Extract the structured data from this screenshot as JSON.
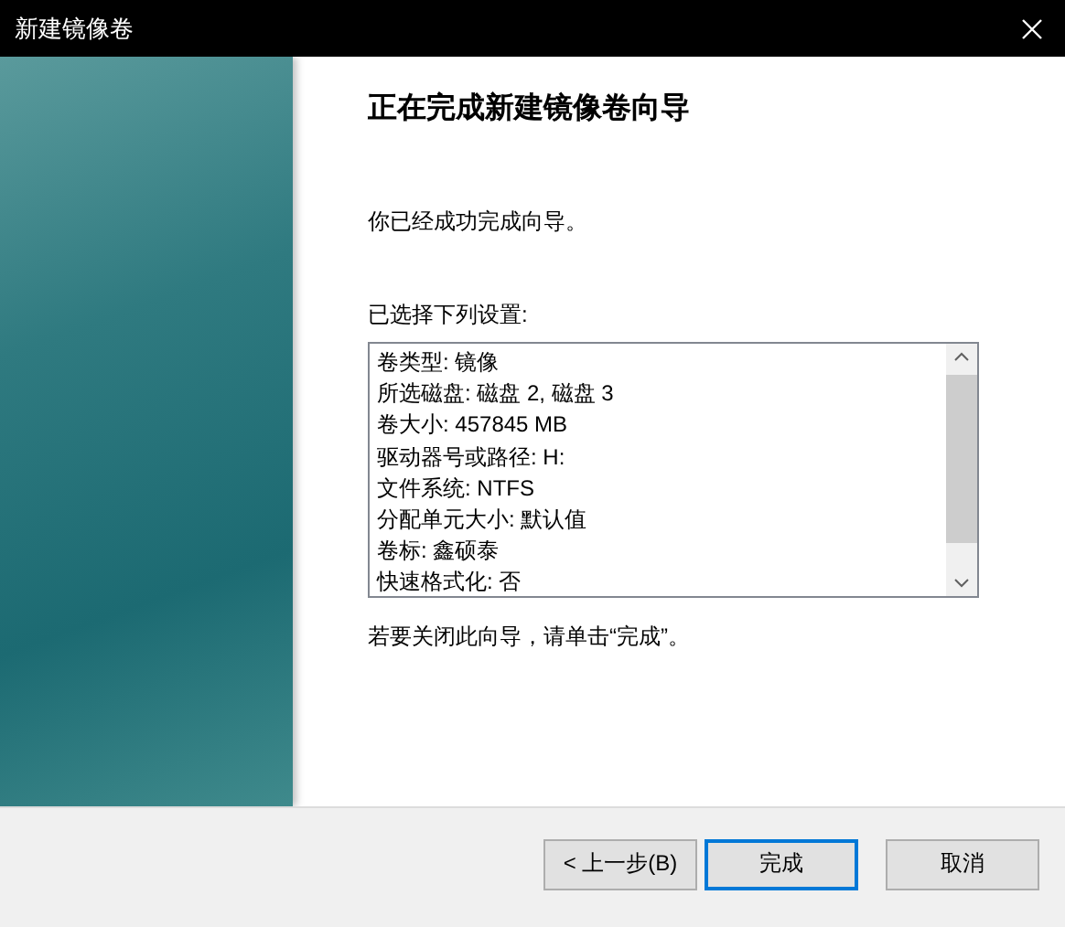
{
  "window": {
    "title": "新建镜像卷"
  },
  "heading": "正在完成新建镜像卷向导",
  "message": "你已经成功完成向导。",
  "settings_label": "已选择下列设置:",
  "settings": [
    "卷类型: 镜像",
    "所选磁盘: 磁盘 2, 磁盘 3",
    "卷大小: 457845 MB",
    "驱动器号或路径: H:",
    "文件系统: NTFS",
    "分配单元大小: 默认值",
    "卷标: 鑫硕泰",
    "快速格式化: 否"
  ],
  "closing_hint": "若要关闭此向导，请单击“完成”。",
  "buttons": [
    {
      "label": "< 上一步(B)",
      "default": false
    },
    {
      "label": "完成",
      "default": true
    },
    {
      "label": "取消",
      "default": false
    }
  ]
}
